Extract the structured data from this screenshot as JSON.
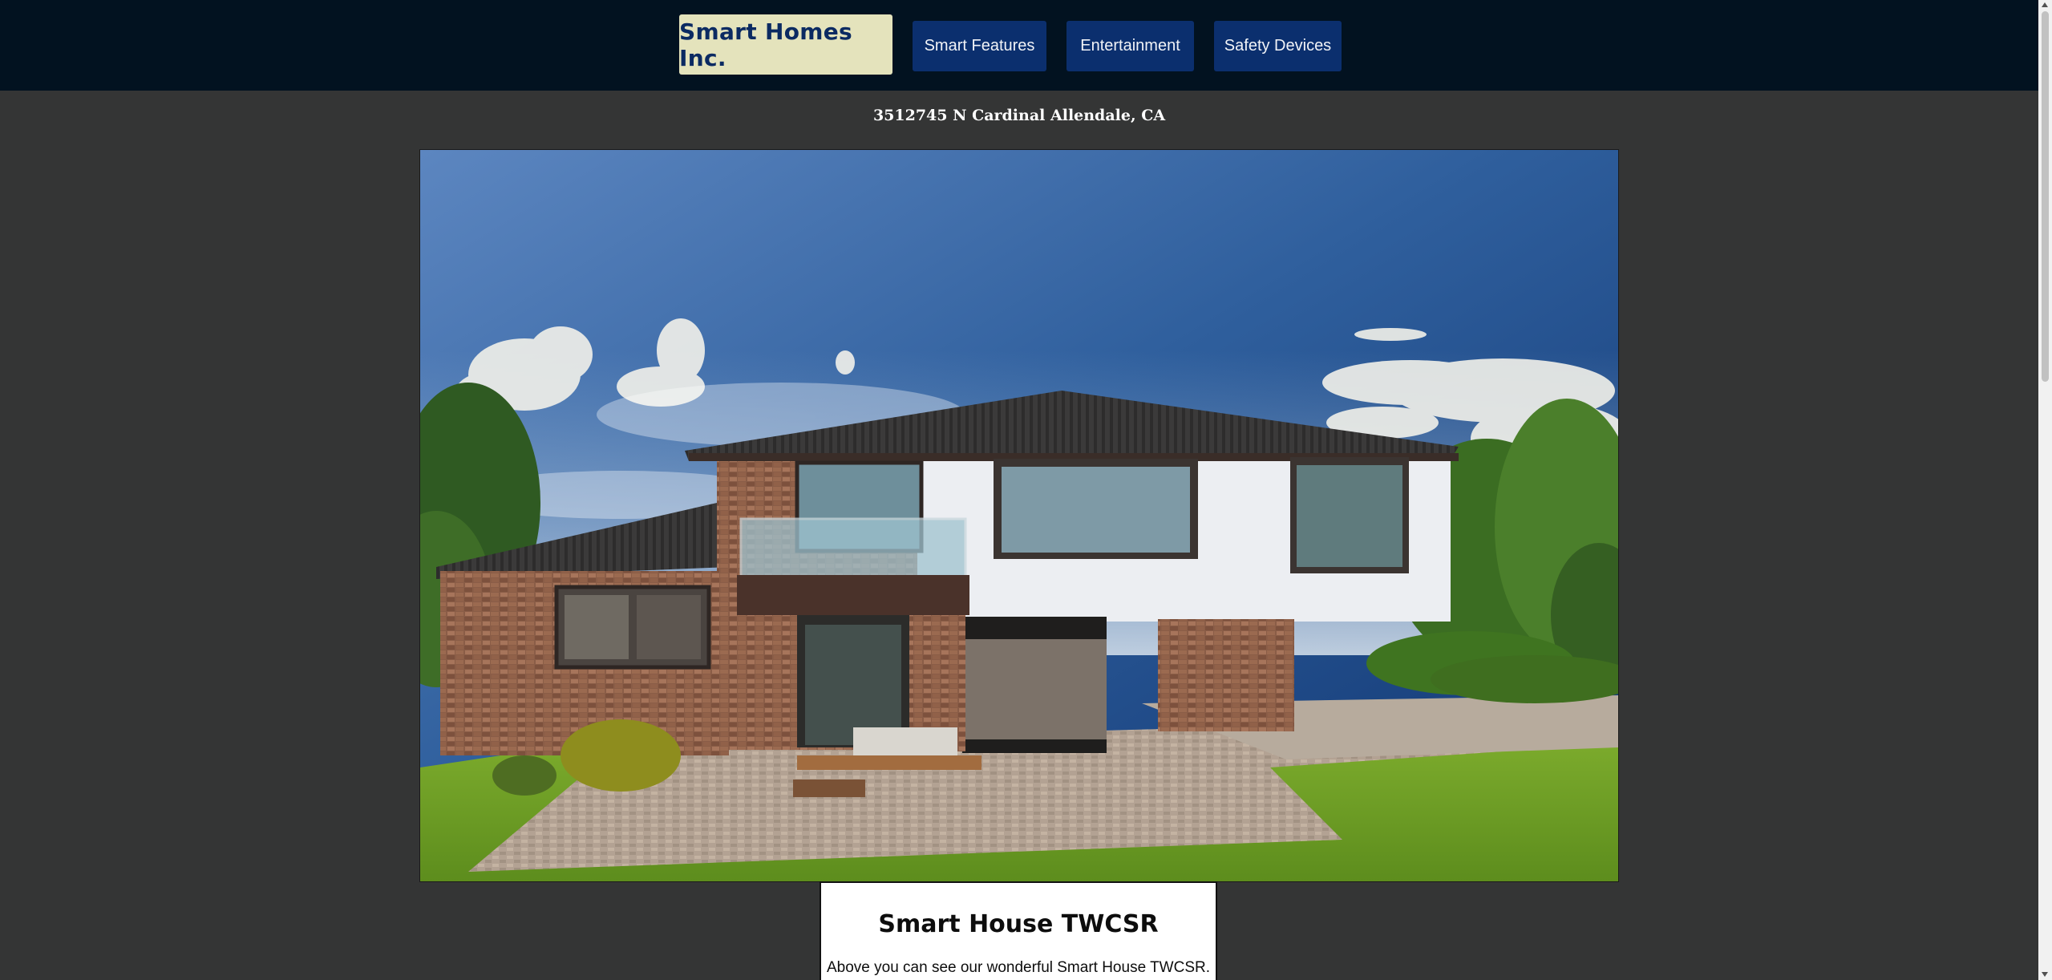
{
  "header": {
    "brand": "Smart Homes Inc.",
    "nav": [
      {
        "label": "Smart Features"
      },
      {
        "label": "Entertainment"
      },
      {
        "label": "Safety Devices"
      }
    ]
  },
  "address": "3512745 N Cardinal Allendale, CA",
  "card": {
    "title": "Smart House TWCSR",
    "text": "Above you can see our wonderful Smart House TWCSR."
  },
  "colors": {
    "topbar": "#021220",
    "page_bg": "#343535",
    "brand_bg": "#e4e3bc",
    "brand_text": "#0b2a62",
    "nav_bg": "#0b2f6e"
  }
}
